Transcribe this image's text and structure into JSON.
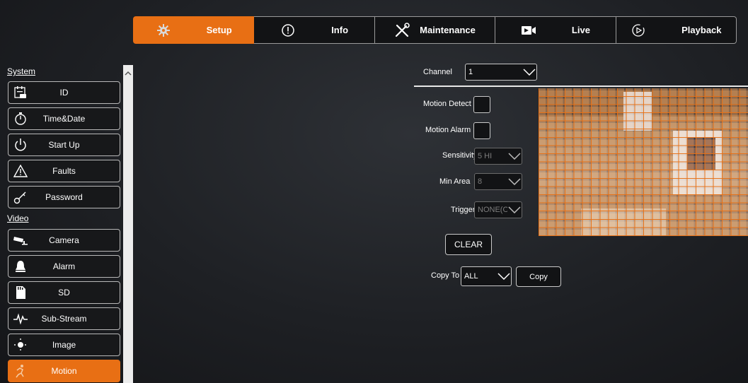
{
  "nav": {
    "tabs": [
      {
        "label": "Setup",
        "icon": "gear-icon",
        "active": true
      },
      {
        "label": "Info",
        "icon": "info-icon",
        "active": false
      },
      {
        "label": "Maintenance",
        "icon": "tools-icon",
        "active": false
      },
      {
        "label": "Live",
        "icon": "video-camera-icon",
        "active": false
      },
      {
        "label": "Playback",
        "icon": "play-circle-icon",
        "active": false
      }
    ]
  },
  "sidebar": {
    "sections": [
      {
        "label": "System",
        "items": [
          {
            "label": "ID",
            "icon": "id-card-icon"
          },
          {
            "label": "Time&Date",
            "icon": "stopwatch-icon"
          },
          {
            "label": "Start Up",
            "icon": "power-icon"
          },
          {
            "label": "Faults",
            "icon": "warning-icon"
          },
          {
            "label": "Password",
            "icon": "key-icon"
          }
        ]
      },
      {
        "label": "Video",
        "items": [
          {
            "label": "Camera",
            "icon": "cctv-camera-icon"
          },
          {
            "label": "Alarm",
            "icon": "bell-icon"
          },
          {
            "label": "SD",
            "icon": "sd-card-icon"
          },
          {
            "label": "Sub-Stream",
            "icon": "waveform-icon"
          },
          {
            "label": "Image",
            "icon": "brightness-icon"
          },
          {
            "label": "Motion",
            "icon": "running-man-icon",
            "active": true
          }
        ]
      }
    ]
  },
  "form": {
    "channel_label": "Channel",
    "channel_value": "1",
    "motion_detect_label": "Motion Detect",
    "motion_alarm_label": "Motion Alarm",
    "sensitivity_label": "Sensitivity",
    "sensitivity_value": "5 HI",
    "min_area_label": "Min Area",
    "min_area_value": "8",
    "trigger_label": "Trigger",
    "trigger_value": "NONE(O",
    "clear_label": "CLEAR",
    "copy_to_label": "Copy To",
    "copy_to_value": "ALL",
    "copy_label": "Copy"
  },
  "colors": {
    "accent": "#e86f14",
    "background": "#1e2024",
    "border": "#c9c9c9"
  }
}
